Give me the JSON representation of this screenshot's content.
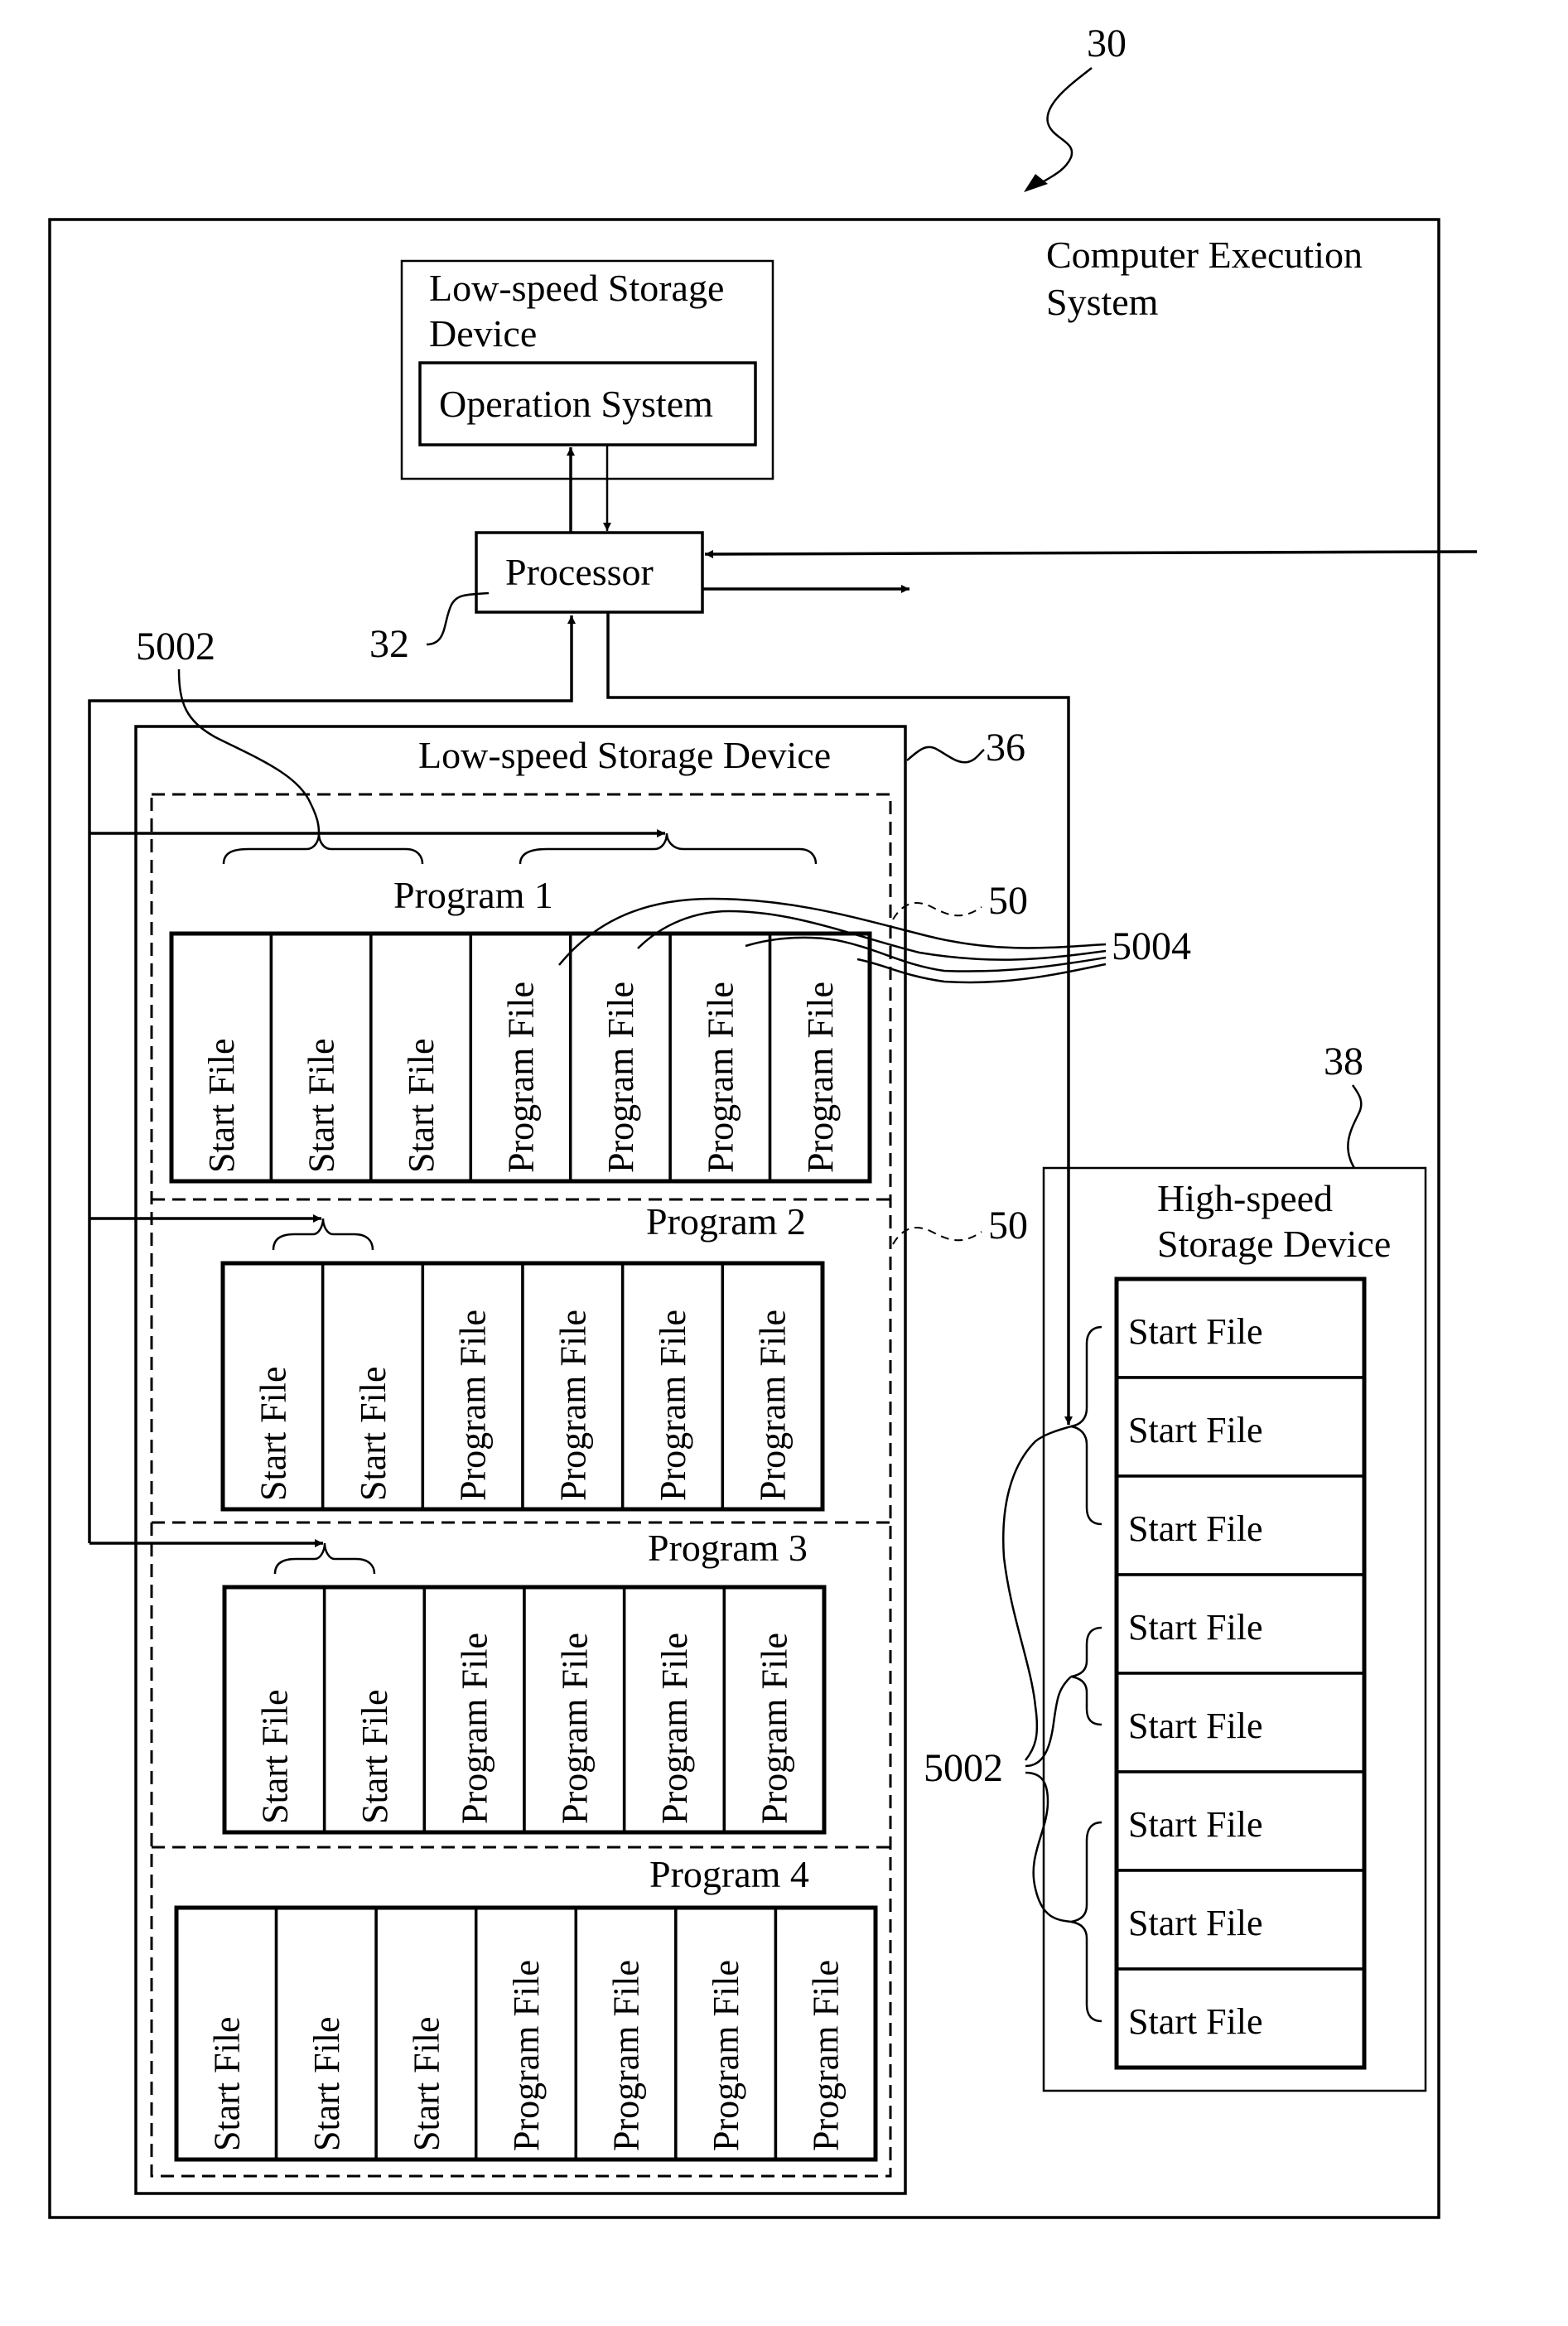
{
  "figure": {
    "reference_numeral": "30",
    "system_label_line1": "Computer Execution",
    "system_label_line2": "System"
  },
  "os_storage": {
    "title_line1": "Low-speed Storage",
    "title_line2": "Device",
    "inner_label": "Operation System"
  },
  "processor": {
    "label": "Processor",
    "reference_numeral": "32"
  },
  "low_speed_storage": {
    "title": "Low-speed Storage Device",
    "reference_numeral": "36",
    "program_block_numeral": "50",
    "program_block_numeral_2": "50",
    "start_file_group_numeral": "5002",
    "program_file_group_numeral": "5004",
    "programs": [
      {
        "name": "Program 1",
        "files": [
          "Start File",
          "Start File",
          "Start File",
          "Program File",
          "Program File",
          "Program File",
          "Program File"
        ]
      },
      {
        "name": "Program 2",
        "files": [
          "Start File",
          "Start File",
          "Program File",
          "Program File",
          "Program File",
          "Program File"
        ]
      },
      {
        "name": "Program 3",
        "files": [
          "Start File",
          "Start File",
          "Program File",
          "Program File",
          "Program File",
          "Program File"
        ]
      },
      {
        "name": "Program 4",
        "files": [
          "Start File",
          "Start File",
          "Start File",
          "Program File",
          "Program File",
          "Program File",
          "Program File"
        ]
      }
    ]
  },
  "high_speed_storage": {
    "title_line1": "High-speed",
    "title_line2": "Storage Device",
    "reference_numeral": "38",
    "start_file_group_numeral": "5002",
    "files": [
      "Start File",
      "Start File",
      "Start File",
      "Start File",
      "Start File",
      "Start File",
      "Start File",
      "Start File"
    ]
  }
}
